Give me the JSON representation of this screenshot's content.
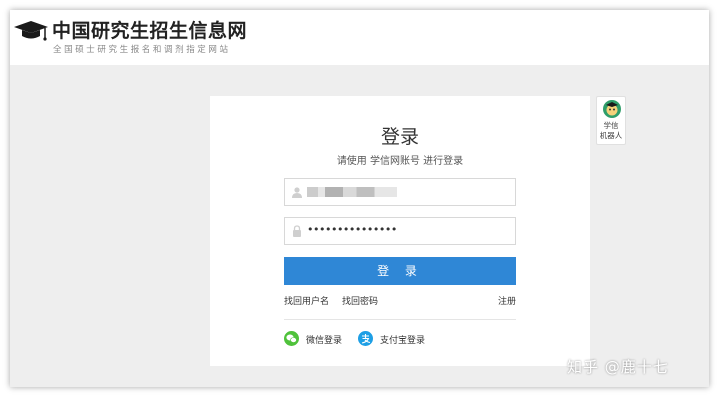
{
  "header": {
    "title": "中国研究生招生信息网",
    "subtitle": "全国硕士研究生报名和调剂指定网站"
  },
  "login": {
    "title": "登录",
    "subtitle": "请使用 学信网账号 进行登录",
    "password_value": "•••••••••••••••",
    "button_label": "登 录",
    "forgot_username": "找回用户名",
    "forgot_password": "找回密码",
    "register": "注册",
    "wechat_login": "微信登录",
    "alipay_login": "支付宝登录"
  },
  "robot": {
    "line1": "学信",
    "line2": "机器人"
  },
  "watermark": "知乎 @鹿十七",
  "colors": {
    "primary": "#2f87d6",
    "wechat": "#4fc23b",
    "alipay": "#1e9fe5",
    "background": "#eeeeee"
  },
  "icons": [
    "graduation-cap-icon",
    "user-icon",
    "lock-icon",
    "wechat-icon",
    "alipay-icon",
    "robot-icon"
  ]
}
